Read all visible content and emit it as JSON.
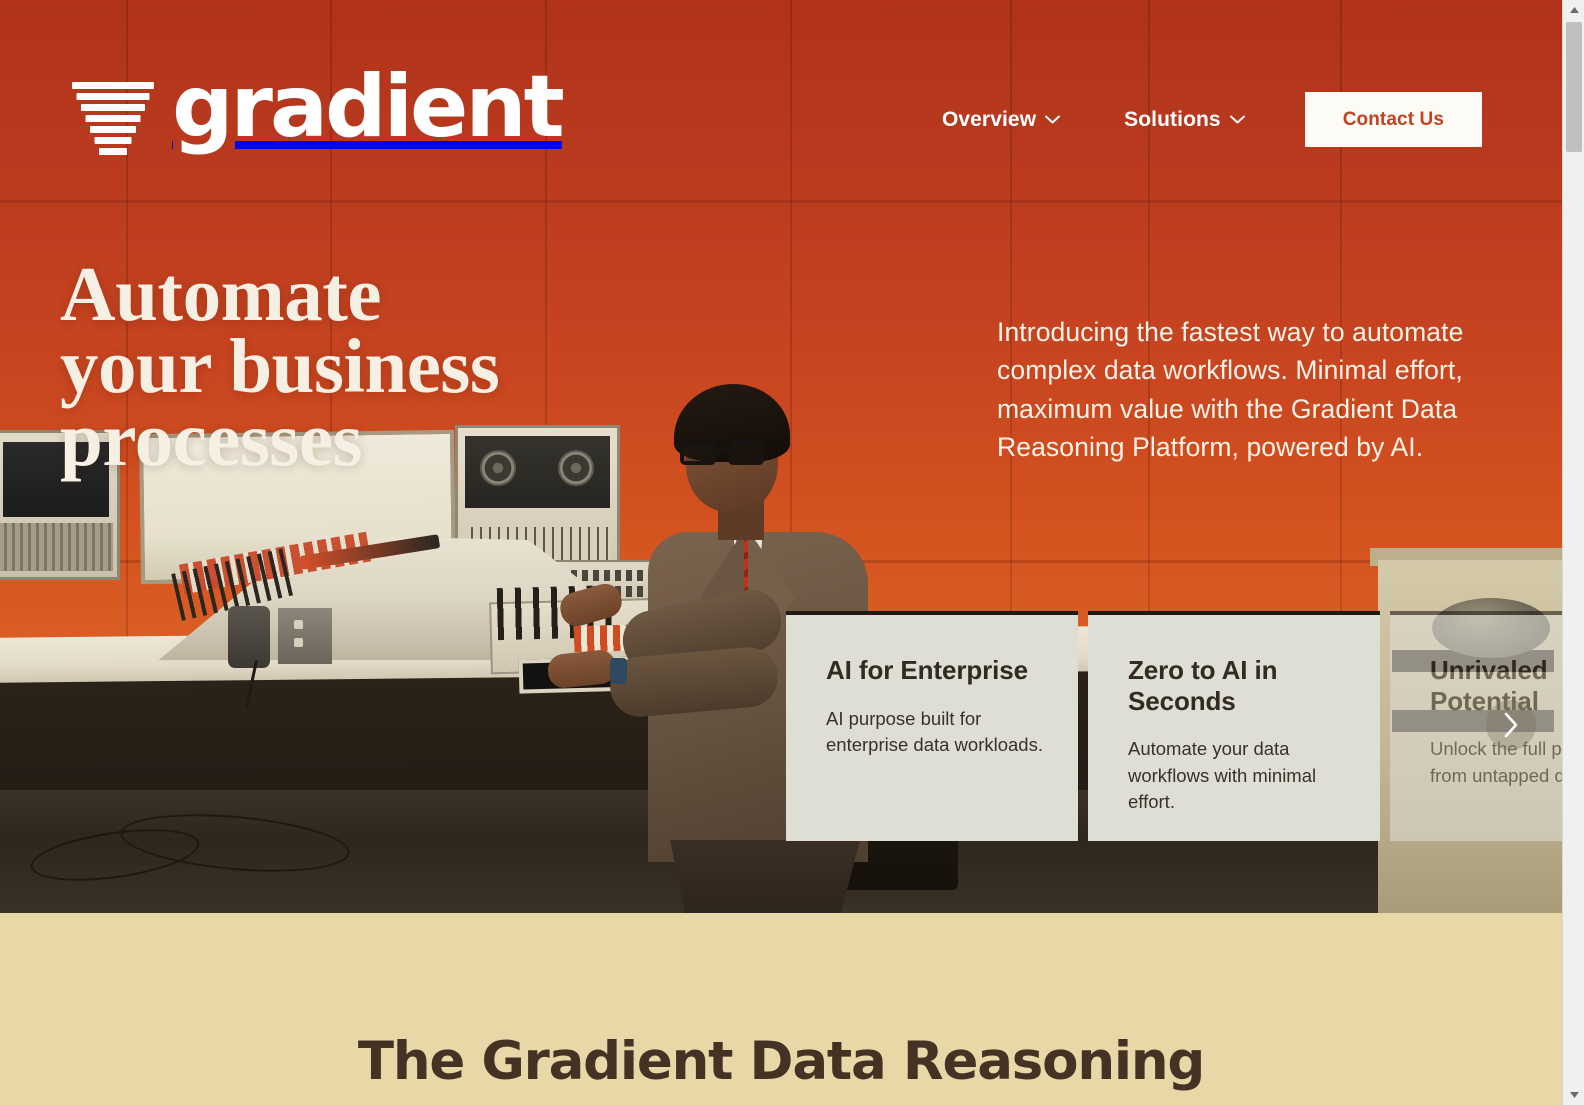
{
  "brand": {
    "name": "gradient",
    "logo_icon": "funnel-stripes-logo"
  },
  "nav": {
    "items": [
      {
        "label": "Overview",
        "icon": "chevron-down-icon"
      },
      {
        "label": "Solutions",
        "icon": "chevron-down-icon"
      }
    ],
    "cta": {
      "label": "Contact Us"
    }
  },
  "hero": {
    "headline_lines": [
      "Automate",
      "your business",
      "processes"
    ],
    "subtext": "Introducing the fastest way to automate complex data workflows. Minimal effort, maximum value with the Gradient Data Reasoning Platform, powered by AI.",
    "illustration_alt": "Retro illustration of a man in a brown suit operating a vintage computer console"
  },
  "carousel": {
    "next_icon": "chevron-right-icon",
    "cards": [
      {
        "title": "AI for Enterprise",
        "body": "AI purpose built for enterprise data workloads."
      },
      {
        "title": "Zero to AI in Seconds",
        "body": "Automate your data workflows with minimal effort."
      },
      {
        "title": "Unrivaled Potential",
        "body": "Unlock the full potential from untapped data."
      }
    ]
  },
  "lower_section": {
    "heading": "The Gradient Data Reasoning"
  },
  "scrollbar": {
    "up_icon": "scroll-up-arrow-icon",
    "down_icon": "scroll-down-arrow-icon"
  },
  "colors": {
    "brand_orange_top": "#B93A1E",
    "brand_orange_bottom": "#E2692E",
    "cream": "#E8D8A8",
    "card_bg": "#DEDED4",
    "text_dark": "#332A22",
    "cta_text": "#C0441F",
    "headline_cream": "#F6F0E4"
  }
}
